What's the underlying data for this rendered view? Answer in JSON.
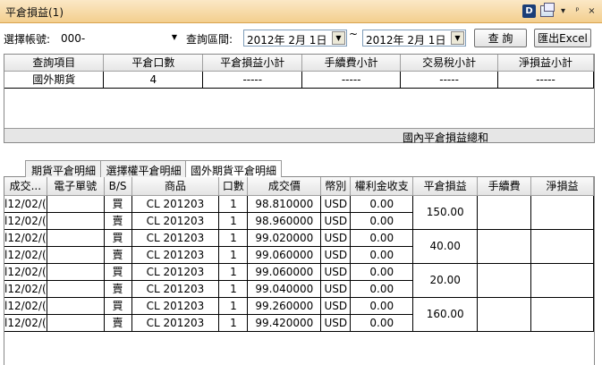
{
  "window": {
    "title": "平倉損益(1)",
    "icon_label": "D",
    "minimize_glyph": "▾",
    "pin_glyph": "ᵖ",
    "close_glyph": "×"
  },
  "filter": {
    "account_label": "選擇帳號:",
    "account_value": "000-",
    "range_label": "查詢區間:",
    "start_date": "2012年  2月  1日",
    "range_sep": "~",
    "end_date": "2012年  2月  1日",
    "query_button": "查 詢",
    "export_button": "匯出Excel"
  },
  "summary": {
    "headers": [
      "查詢項目",
      "平倉口數",
      "平倉損益小計",
      "手續費小計",
      "交易稅小計",
      "淨損益小計"
    ],
    "rows": [
      [
        "國外期貨",
        "4",
        "-----",
        "-----",
        "-----",
        "-----"
      ]
    ],
    "footer": "國內平倉損益總和"
  },
  "tabs": [
    {
      "label": "期貨平倉明細",
      "active": false
    },
    {
      "label": "選擇權平倉明細",
      "active": false
    },
    {
      "label": "國外期貨平倉明細",
      "active": true
    }
  ],
  "detail": {
    "headers": [
      "成交...",
      "電子單號",
      "B/S",
      "商品",
      "口數",
      "成交價",
      "幣別",
      "權利金收支",
      "平倉損益",
      "手續費",
      "淨損益"
    ],
    "rows": [
      [
        "l12/02/(",
        "",
        "買",
        "CL 201203",
        "1",
        "98.810000",
        "USD",
        "0.00"
      ],
      [
        "l12/02/(",
        "",
        "賣",
        "CL 201203",
        "1",
        "98.960000",
        "USD",
        "0.00"
      ],
      [
        "l12/02/(",
        "",
        "買",
        "CL 201203",
        "1",
        "99.020000",
        "USD",
        "0.00"
      ],
      [
        "l12/02/(",
        "",
        "賣",
        "CL 201203",
        "1",
        "99.060000",
        "USD",
        "0.00"
      ],
      [
        "l12/02/(",
        "",
        "買",
        "CL 201203",
        "1",
        "99.060000",
        "USD",
        "0.00"
      ],
      [
        "l12/02/(",
        "",
        "賣",
        "CL 201203",
        "1",
        "99.040000",
        "USD",
        "0.00"
      ],
      [
        "l12/02/(",
        "",
        "買",
        "CL 201203",
        "1",
        "99.260000",
        "USD",
        "0.00"
      ],
      [
        "l12/02/(",
        "",
        "賣",
        "CL 201203",
        "1",
        "99.420000",
        "USD",
        "0.00"
      ]
    ],
    "pairs": [
      "150.00",
      "40.00",
      "20.00",
      "160.00"
    ]
  }
}
